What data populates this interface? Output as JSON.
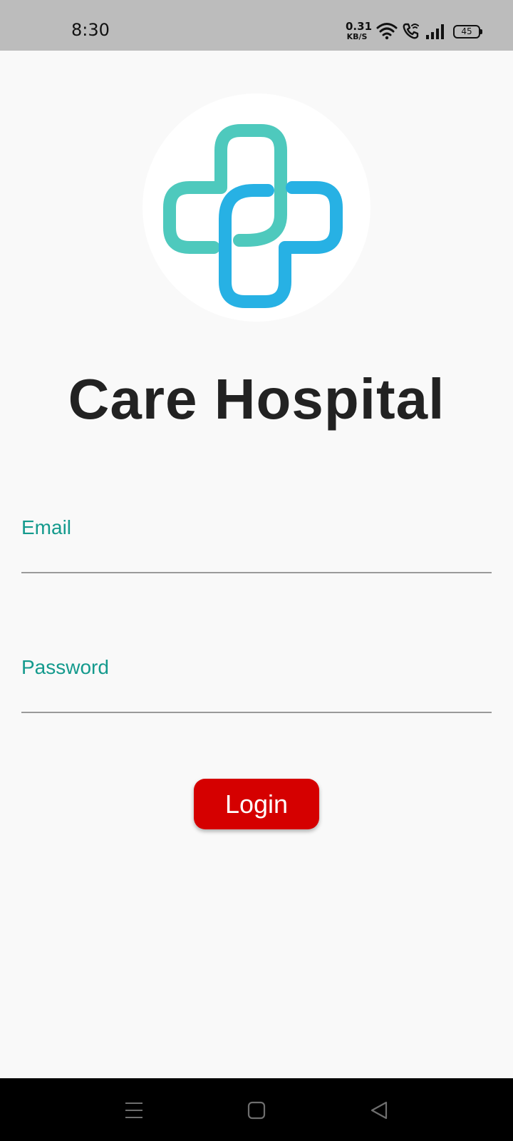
{
  "status_bar": {
    "time": "8:30",
    "net_speed_value": "0.31",
    "net_speed_unit": "KB/S",
    "battery": "45",
    "icons": [
      "wifi-icon",
      "wifi-call-icon",
      "signal-icon",
      "battery-icon"
    ]
  },
  "logo": {
    "icon": "medical-cross-icon",
    "colors": {
      "teal": "#4ec9bd",
      "blue": "#27b1e4"
    }
  },
  "app_title": "Care Hospital",
  "form": {
    "email_label": "Email",
    "email_value": "",
    "password_label": "Password",
    "password_value": "",
    "login_label": "Login"
  },
  "colors": {
    "accent": "#149a8d",
    "button": "#d50000",
    "background": "#f9f9f9",
    "status_bar": "#bcbcbc",
    "nav_bar": "#000000"
  },
  "nav_bar": {
    "icons": [
      "menu-icon",
      "home-icon",
      "back-icon"
    ]
  }
}
